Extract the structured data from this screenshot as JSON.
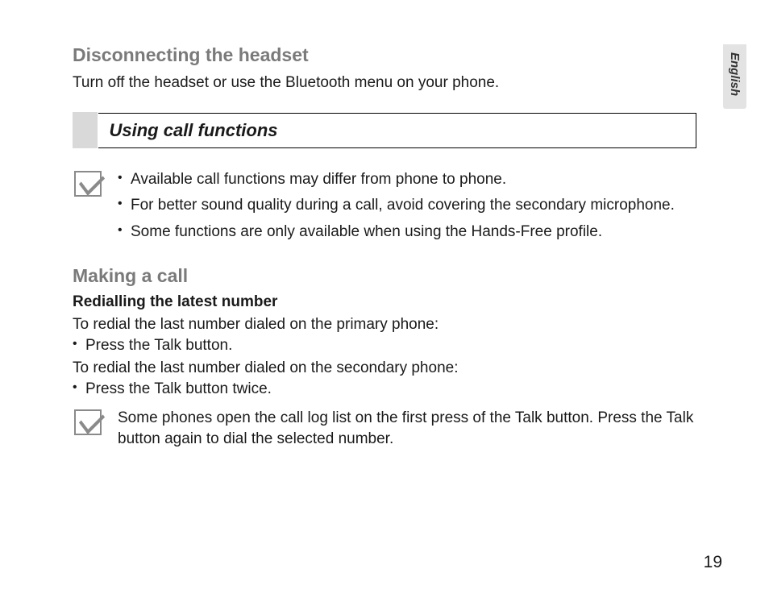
{
  "langTab": "English",
  "section1": {
    "heading": "Disconnecting the headset",
    "text": "Turn off the headset or use the Bluetooth menu on your phone."
  },
  "boxedHeading": "Using call functions",
  "note1": {
    "items": [
      "Available call functions may differ from phone to phone.",
      "For better sound quality during a call, avoid covering the secondary microphone.",
      "Some functions are only available when using the Hands-Free profile."
    ]
  },
  "section2": {
    "heading": "Making a call",
    "subHeading": "Redialling the latest number",
    "p1": "To redial the last number dialed on the primary phone:",
    "b1": "Press the Talk button.",
    "p2": "To redial the last number dialed on the secondary phone:",
    "b2": "Press the Talk button twice."
  },
  "note2": {
    "text": "Some phones open the call log list on the first press of the Talk button. Press the Talk button again to dial the selected number."
  },
  "pageNumber": "19"
}
